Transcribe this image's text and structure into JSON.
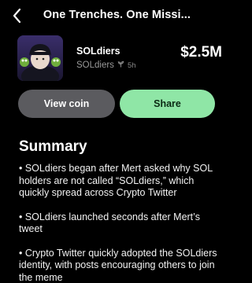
{
  "header": {
    "title": "One Trenches. One Missi..."
  },
  "coin": {
    "name": "SOLdiers",
    "subtitle": "SOLdiers",
    "age": "5h",
    "market_cap": "$2.5M"
  },
  "actions": {
    "view_label": "View coin",
    "share_label": "Share"
  },
  "summary": {
    "heading": "Summary",
    "bullets": [
      "• SOLdiers began after Mert asked why SOL holders are not called “SOLdiers,” which quickly spread across Crypto Twitter",
      "• SOLdiers launched seconds after Mert’s tweet",
      "• Crypto Twitter quickly adopted the SOLdiers identity, with posts encouraging others to join the meme"
    ]
  },
  "colors": {
    "background": "#000000",
    "share_button": "#8fe6a6",
    "view_button": "#5b5b5f"
  }
}
